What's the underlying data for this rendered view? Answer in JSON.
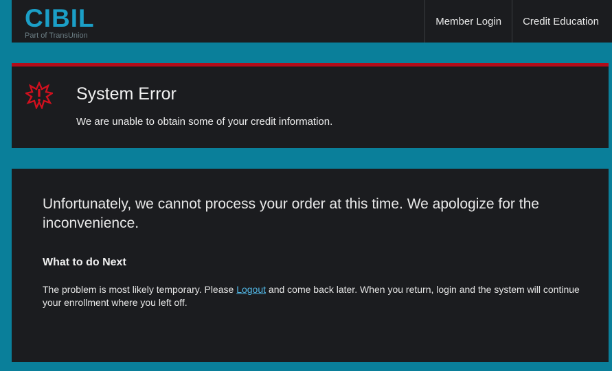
{
  "header": {
    "logo_text": "CIBIL",
    "logo_sub": "Part of TransUnion",
    "nav": [
      {
        "label": "Member Login"
      },
      {
        "label": "Credit Education"
      }
    ]
  },
  "error": {
    "icon": "alert-burst-icon",
    "title": "System Error",
    "message": "We are unable to obtain some of your credit information."
  },
  "main": {
    "lead": "Unfortunately, we cannot process your order at this time. We apologize for the inconvenience.",
    "next_heading": "What to do Next",
    "next_text_before": "The problem is most likely temporary. Please ",
    "next_link": "Logout",
    "next_text_after": " and come back later. When you return, login and the system will continue your enrollment where you left off."
  },
  "colors": {
    "background": "#0a7f9a",
    "panel": "#1b1c1f",
    "accent_red": "#b30d1a",
    "logo_blue": "#1b9fc7",
    "link": "#52b8e6"
  }
}
